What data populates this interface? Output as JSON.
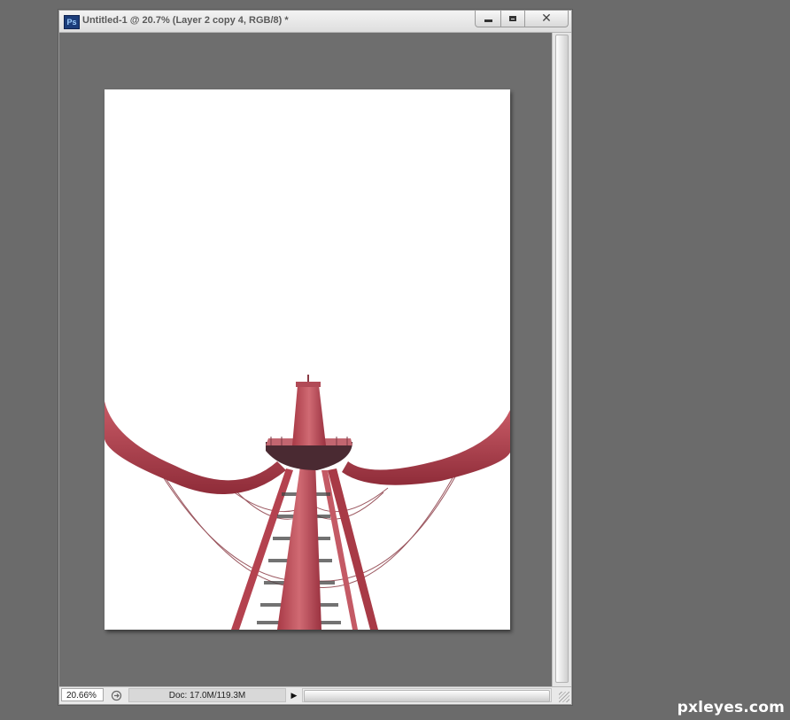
{
  "window": {
    "app_icon": "photoshop-logo",
    "app_icon_text": "Ps",
    "title": "Untitled-1 @ 20.7% (Layer 2 copy 4, RGB/8) *",
    "controls": {
      "minimize_icon": "minimize-icon",
      "maximize_icon": "maximize-icon",
      "close_icon": "close-icon",
      "close_glyph": "✕"
    }
  },
  "statusbar": {
    "zoom": "20.66%",
    "doc_info": "Doc: 17.0M/119.3M",
    "export_icon": "export-icon",
    "arrow_icon": "play-arrow-icon",
    "arrow_glyph": "▶"
  },
  "document": {
    "background": "#ffffff",
    "artwork": "red-tower-with-curved-arms",
    "tower_color": "#b94a55"
  },
  "watermark": "pxleyes.com",
  "colors": {
    "workspace": "#6b6b6b",
    "canvas_bg": "#6e6e6e",
    "chrome": "#e9e9e9"
  }
}
